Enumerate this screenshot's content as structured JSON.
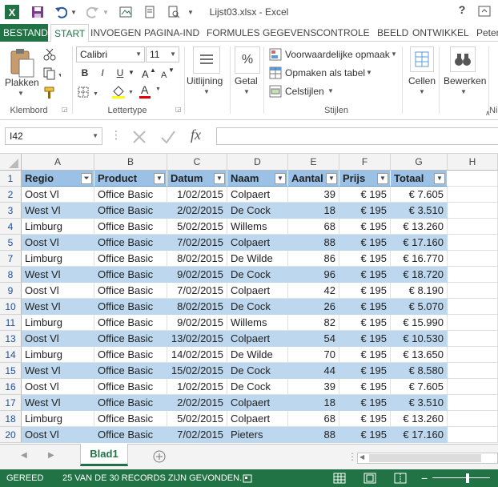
{
  "window": {
    "title": "Lijst03.xlsx - Excel",
    "help": "?",
    "profile": "Peter"
  },
  "tabs": [
    "BESTAND",
    "START",
    "INVOEGEN",
    "PAGINA-IND",
    "FORMULES",
    "GEGEVENS",
    "CONTROLE",
    "BEELD",
    "ONTWIKKEL"
  ],
  "ribbon": {
    "clipboard": {
      "paste": "Plakken",
      "group": "Klembord"
    },
    "font": {
      "name": "Calibri",
      "size": "11",
      "bold": "B",
      "italic": "I",
      "underline": "U",
      "fill_letter": "A",
      "group": "Lettertype"
    },
    "alignment": {
      "label": "Uitlijning"
    },
    "number": {
      "symbol": "%",
      "label": "Getal"
    },
    "styles": {
      "cond_format": "Voorwaardelijke opmaak",
      "format_table": "Opmaken als tabel",
      "cell_styles": "Celstijlen",
      "group": "Stijlen"
    },
    "cells": {
      "label": "Cellen"
    },
    "editing": {
      "label": "Bewerken"
    },
    "next_group_hint": "Ni"
  },
  "formula_bar": {
    "name_box": "I42",
    "fx": "fx",
    "value": ""
  },
  "grid": {
    "columns": [
      "A",
      "B",
      "C",
      "D",
      "E",
      "F",
      "G",
      "H"
    ],
    "header_row": {
      "row": "1",
      "cells": [
        "Regio",
        "Product",
        "Datum",
        "Naam",
        "Aantal",
        "Prijs",
        "Totaal"
      ]
    },
    "rows": [
      {
        "row": "2",
        "cells": [
          "Oost Vl",
          "Office Basic",
          "1/02/2015",
          "Colpaert",
          "39",
          "€ 195",
          "€ 7.605"
        ]
      },
      {
        "row": "3",
        "cells": [
          "West Vl",
          "Office Basic",
          "2/02/2015",
          "De Cock",
          "18",
          "€ 195",
          "€ 3.510"
        ]
      },
      {
        "row": "4",
        "cells": [
          "Limburg",
          "Office Basic",
          "5/02/2015",
          "Willems",
          "68",
          "€ 195",
          "€ 13.260"
        ]
      },
      {
        "row": "5",
        "cells": [
          "Oost Vl",
          "Office Basic",
          "7/02/2015",
          "Colpaert",
          "88",
          "€ 195",
          "€ 17.160"
        ]
      },
      {
        "row": "7",
        "cells": [
          "Limburg",
          "Office Basic",
          "8/02/2015",
          "De Wilde",
          "86",
          "€ 195",
          "€ 16.770"
        ]
      },
      {
        "row": "8",
        "cells": [
          "West Vl",
          "Office Basic",
          "9/02/2015",
          "De Cock",
          "96",
          "€ 195",
          "€ 18.720"
        ]
      },
      {
        "row": "9",
        "cells": [
          "Oost Vl",
          "Office Basic",
          "7/02/2015",
          "Colpaert",
          "42",
          "€ 195",
          "€ 8.190"
        ]
      },
      {
        "row": "10",
        "cells": [
          "West Vl",
          "Office Basic",
          "8/02/2015",
          "De Cock",
          "26",
          "€ 195",
          "€ 5.070"
        ]
      },
      {
        "row": "11",
        "cells": [
          "Limburg",
          "Office Basic",
          "9/02/2015",
          "Willems",
          "82",
          "€ 195",
          "€ 15.990"
        ]
      },
      {
        "row": "13",
        "cells": [
          "Oost Vl",
          "Office Basic",
          "13/02/2015",
          "Colpaert",
          "54",
          "€ 195",
          "€ 10.530"
        ]
      },
      {
        "row": "14",
        "cells": [
          "Limburg",
          "Office Basic",
          "14/02/2015",
          "De Wilde",
          "70",
          "€ 195",
          "€ 13.650"
        ]
      },
      {
        "row": "15",
        "cells": [
          "West Vl",
          "Office Basic",
          "15/02/2015",
          "De Cock",
          "44",
          "€ 195",
          "€ 8.580"
        ]
      },
      {
        "row": "16",
        "cells": [
          "Oost Vl",
          "Office Basic",
          "1/02/2015",
          "De Cock",
          "39",
          "€ 195",
          "€ 7.605"
        ]
      },
      {
        "row": "17",
        "cells": [
          "West Vl",
          "Office Basic",
          "2/02/2015",
          "Colpaert",
          "18",
          "€ 195",
          "€ 3.510"
        ]
      },
      {
        "row": "18",
        "cells": [
          "Limburg",
          "Office Basic",
          "5/02/2015",
          "Colpaert",
          "68",
          "€ 195",
          "€ 13.260"
        ]
      },
      {
        "row": "20",
        "cells": [
          "Oost Vl",
          "Office Basic",
          "7/02/2015",
          "Pieters",
          "88",
          "€ 195",
          "€ 17.160"
        ]
      }
    ]
  },
  "sheet_tabs": {
    "active": "Blad1"
  },
  "status": {
    "mode": "GEREED",
    "records": "25 VAN DE 30 RECORDS ZIJN GEVONDEN."
  },
  "colors": {
    "accent": "#217346",
    "table_header": "#9bc2e6",
    "band": "#bdd7ee"
  }
}
